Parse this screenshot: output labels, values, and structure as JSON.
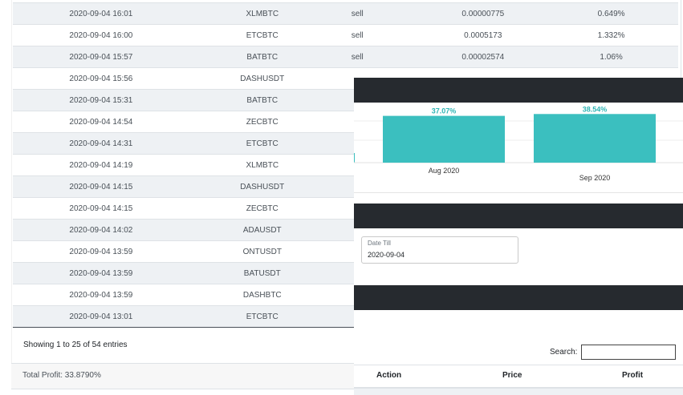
{
  "trades": {
    "rows": [
      {
        "date": "2020-09-04 16:01",
        "pair": "XLMBTC",
        "action": "sell",
        "price": "0.00000775",
        "profit": "0.649%"
      },
      {
        "date": "2020-09-04 16:00",
        "pair": "ETCBTC",
        "action": "sell",
        "price": "0.0005173",
        "profit": "1.332%"
      },
      {
        "date": "2020-09-04 15:57",
        "pair": "BATBTC",
        "action": "sell",
        "price": "0.00002574",
        "profit": "1.06%"
      },
      {
        "date": "2020-09-04 15:56",
        "pair": "DASHUSDT",
        "action": "",
        "price": "",
        "profit": ""
      },
      {
        "date": "2020-09-04 15:31",
        "pair": "BATBTC",
        "action": "",
        "price": "",
        "profit": ""
      },
      {
        "date": "2020-09-04 14:54",
        "pair": "ZECBTC",
        "action": "",
        "price": "",
        "profit": ""
      },
      {
        "date": "2020-09-04 14:31",
        "pair": "ETCBTC",
        "action": "",
        "price": "",
        "profit": ""
      },
      {
        "date": "2020-09-04 14:19",
        "pair": "XLMBTC",
        "action": "",
        "price": "",
        "profit": ""
      },
      {
        "date": "2020-09-04 14:15",
        "pair": "DASHUSDT",
        "action": "",
        "price": "",
        "profit": ""
      },
      {
        "date": "2020-09-04 14:15",
        "pair": "ZECBTC",
        "action": "",
        "price": "",
        "profit": ""
      },
      {
        "date": "2020-09-04 14:02",
        "pair": "ADAUSDT",
        "action": "",
        "price": "",
        "profit": ""
      },
      {
        "date": "2020-09-04 13:59",
        "pair": "ONTUSDT",
        "action": "",
        "price": "",
        "profit": ""
      },
      {
        "date": "2020-09-04 13:59",
        "pair": "BATUSDT",
        "action": "",
        "price": "",
        "profit": ""
      },
      {
        "date": "2020-09-04 13:59",
        "pair": "DASHBTC",
        "action": "",
        "price": "",
        "profit": ""
      },
      {
        "date": "2020-09-04 13:01",
        "pair": "ETCBTC",
        "action": "",
        "price": "",
        "profit": ""
      }
    ],
    "showing_text": "Showing 1 to 25 of 54 entries",
    "total_profit_text": "Total Profit: 33.8790%"
  },
  "chart_data": {
    "type": "bar",
    "categories": [
      "Aug 2020",
      "Sep 2020"
    ],
    "values": [
      37.07,
      38.54
    ],
    "data_labels": [
      "37.07%",
      "38.54%"
    ],
    "ylim": [
      0,
      50
    ],
    "color": "#3bbfbf",
    "label_color": "#2fb5b5"
  },
  "filters": {
    "date_till_label": "Date Till",
    "date_till_value": "2020-09-04"
  },
  "search": {
    "label": "Search:",
    "value": ""
  },
  "table2": {
    "headers": {
      "action": "Action",
      "price": "Price",
      "profit": "Profit"
    }
  }
}
